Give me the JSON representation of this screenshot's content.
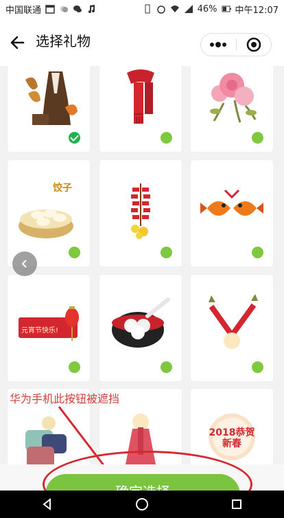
{
  "status": {
    "carrier": "中国联通",
    "signal_label": "46%",
    "time": "中午12:07"
  },
  "nav": {
    "title": "选择礼物",
    "back_icon": "back-arrow-icon",
    "menu_icon": "more-dots-icon",
    "close_icon": "target-close-icon"
  },
  "gifts": [
    {
      "name": "autumn-coat",
      "selected": true
    },
    {
      "name": "red-scarf",
      "selected": false
    },
    {
      "name": "roses",
      "selected": false
    },
    {
      "name": "dumplings",
      "label": "饺子",
      "selected": false
    },
    {
      "name": "firecrackers",
      "selected": false
    },
    {
      "name": "fish",
      "selected": false
    },
    {
      "name": "lantern-banner",
      "label": "元宵节快乐!",
      "selected": false
    },
    {
      "name": "tangyuan",
      "selected": false
    },
    {
      "name": "fireworks",
      "selected": false
    },
    {
      "name": "gifts",
      "selected": false
    },
    {
      "name": "red-dress",
      "selected": false
    },
    {
      "name": "new-year-2018",
      "label": "2018恭贺新春",
      "selected": false
    }
  ],
  "annotation_text": "华为手机此按钮被遮挡",
  "confirm_button": "确定选择",
  "colors": {
    "accent": "#7bc43f",
    "selected": "#23b14d",
    "annotation": "#d7282f"
  }
}
